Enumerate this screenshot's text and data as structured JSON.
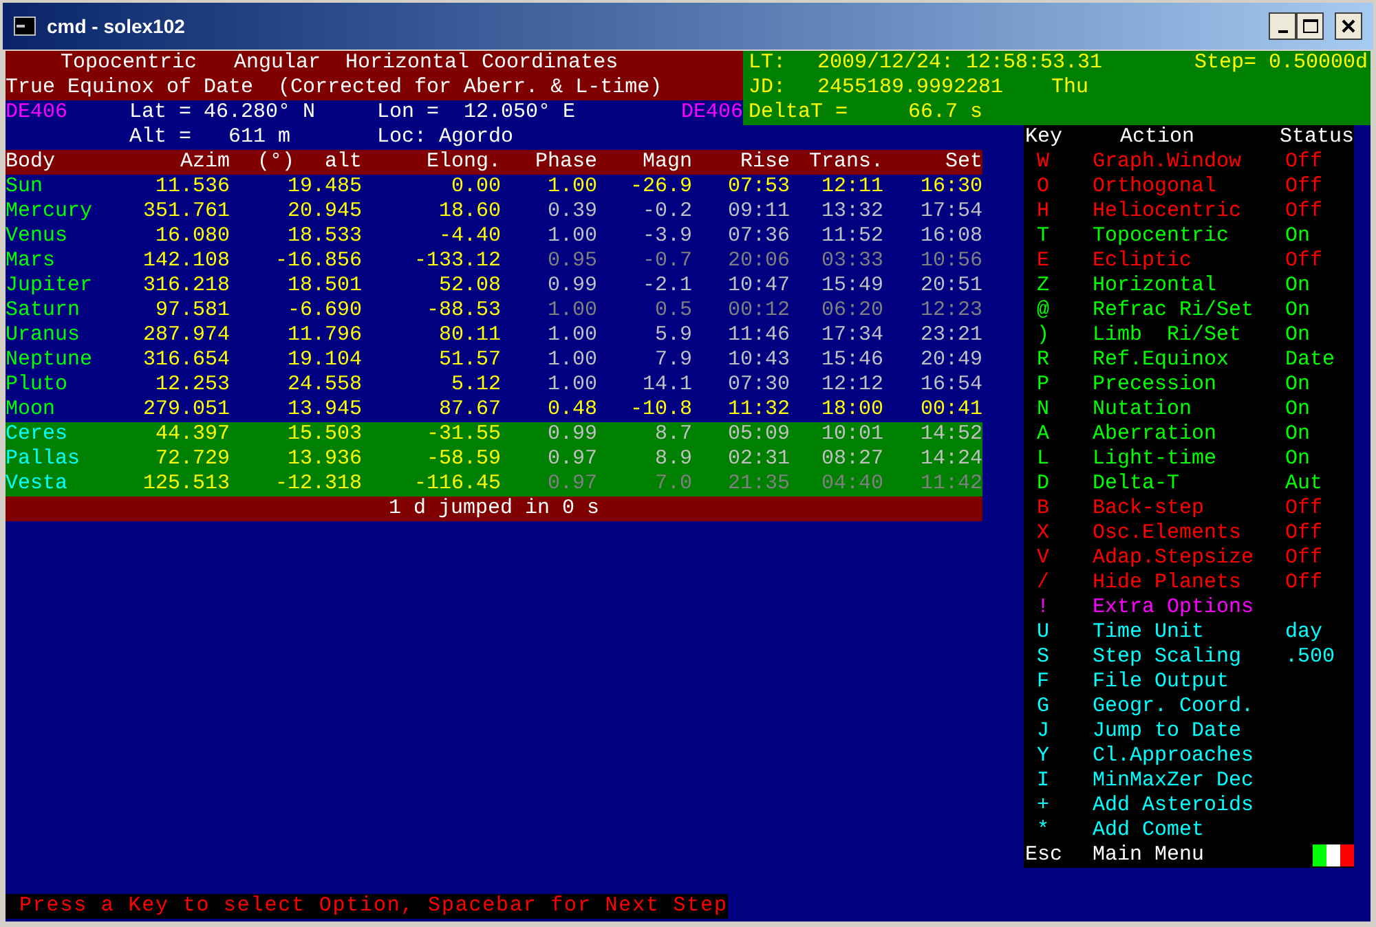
{
  "window": {
    "title": "cmd - solex102"
  },
  "header": {
    "line_1": "Topocentric   Angular  Horizontal Coordinates",
    "line_2": "True Equinox of Date  (Corrected for Aberr. & L-time)",
    "ephemeris_left": "DE406",
    "lat": "Lat = 46.280° N",
    "lon": "Lon =  12.050° E",
    "ephemeris_right": "DE406",
    "alt": "Alt =   611 m",
    "loc": "Loc: Agordo"
  },
  "time_panel": {
    "lt_label": "LT:",
    "lt": "2009/12/24: 12:58:53.31",
    "step": "Step= 0.50000d",
    "jd_label": "JD:",
    "jd": "2455189.9992281",
    "weekday": "Thu",
    "deltat_label": "DeltaT =",
    "deltat": "66.7 s"
  },
  "table": {
    "columns": [
      "Body",
      "Azim",
      "(°)",
      "alt",
      "Elong.",
      "Phase",
      "Magn",
      "Rise",
      "Trans.",
      "Set"
    ],
    "rows": [
      {
        "body": "Sun",
        "azim": "11.536",
        "alt": "19.485",
        "elong": "0.00",
        "phase": "1.00",
        "magn": "-26.9",
        "rise": "07:53",
        "trans": "12:11",
        "set": "16:30",
        "kind": "planet",
        "highlighted": true,
        "dimmed": false
      },
      {
        "body": "Mercury",
        "azim": "351.761",
        "alt": "20.945",
        "elong": "18.60",
        "phase": "0.39",
        "magn": "-0.2",
        "rise": "09:11",
        "trans": "13:32",
        "set": "17:54",
        "kind": "planet",
        "highlighted": false,
        "dimmed": false
      },
      {
        "body": "Venus",
        "azim": "16.080",
        "alt": "18.533",
        "elong": "-4.40",
        "phase": "1.00",
        "magn": "-3.9",
        "rise": "07:36",
        "trans": "11:52",
        "set": "16:08",
        "kind": "planet",
        "highlighted": false,
        "dimmed": false
      },
      {
        "body": "Mars",
        "azim": "142.108",
        "alt": "-16.856",
        "elong": "-133.12",
        "phase": "0.95",
        "magn": "-0.7",
        "rise": "20:06",
        "trans": "03:33",
        "set": "10:56",
        "kind": "planet",
        "highlighted": false,
        "dimmed": true
      },
      {
        "body": "Jupiter",
        "azim": "316.218",
        "alt": "18.501",
        "elong": "52.08",
        "phase": "0.99",
        "magn": "-2.1",
        "rise": "10:47",
        "trans": "15:49",
        "set": "20:51",
        "kind": "planet",
        "highlighted": false,
        "dimmed": false
      },
      {
        "body": "Saturn",
        "azim": "97.581",
        "alt": "-6.690",
        "elong": "-88.53",
        "phase": "1.00",
        "magn": "0.5",
        "rise": "00:12",
        "trans": "06:20",
        "set": "12:23",
        "kind": "planet",
        "highlighted": false,
        "dimmed": true
      },
      {
        "body": "Uranus",
        "azim": "287.974",
        "alt": "11.796",
        "elong": "80.11",
        "phase": "1.00",
        "magn": "5.9",
        "rise": "11:46",
        "trans": "17:34",
        "set": "23:21",
        "kind": "planet",
        "highlighted": false,
        "dimmed": false
      },
      {
        "body": "Neptune",
        "azim": "316.654",
        "alt": "19.104",
        "elong": "51.57",
        "phase": "1.00",
        "magn": "7.9",
        "rise": "10:43",
        "trans": "15:46",
        "set": "20:49",
        "kind": "planet",
        "highlighted": false,
        "dimmed": false
      },
      {
        "body": "Pluto",
        "azim": "12.253",
        "alt": "24.558",
        "elong": "5.12",
        "phase": "1.00",
        "magn": "14.1",
        "rise": "07:30",
        "trans": "12:12",
        "set": "16:54",
        "kind": "planet",
        "highlighted": false,
        "dimmed": false
      },
      {
        "body": "Moon",
        "azim": "279.051",
        "alt": "13.945",
        "elong": "87.67",
        "phase": "0.48",
        "magn": "-10.8",
        "rise": "11:32",
        "trans": "18:00",
        "set": "00:41",
        "kind": "planet",
        "highlighted": true,
        "dimmed": false
      },
      {
        "body": "Ceres",
        "azim": "44.397",
        "alt": "15.503",
        "elong": "-31.55",
        "phase": "0.99",
        "magn": "8.7",
        "rise": "05:09",
        "trans": "10:01",
        "set": "14:52",
        "kind": "asteroid",
        "highlighted": false,
        "dimmed": false
      },
      {
        "body": "Pallas",
        "azim": "72.729",
        "alt": "13.936",
        "elong": "-58.59",
        "phase": "0.97",
        "magn": "8.9",
        "rise": "02:31",
        "trans": "08:27",
        "set": "14:24",
        "kind": "asteroid",
        "highlighted": false,
        "dimmed": false
      },
      {
        "body": "Vesta",
        "azim": "125.513",
        "alt": "-12.318",
        "elong": "-116.45",
        "phase": "0.97",
        "magn": "7.0",
        "rise": "21:35",
        "trans": "04:40",
        "set": "11:42",
        "kind": "asteroid",
        "highlighted": false,
        "dimmed": true
      }
    ]
  },
  "status_line": "1 d jumped in 0 s",
  "menu": {
    "columns": [
      "Key",
      "Action",
      "Status"
    ],
    "items": [
      {
        "key": "W",
        "action": "Graph.Window",
        "status": "Off",
        "color": "#ff0000"
      },
      {
        "key": "O",
        "action": "Orthogonal",
        "status": "Off",
        "color": "#ff0000"
      },
      {
        "key": "H",
        "action": "Heliocentric",
        "status": "Off",
        "color": "#ff0000"
      },
      {
        "key": "T",
        "action": "Topocentric",
        "status": "On",
        "color": "#00ff00"
      },
      {
        "key": "E",
        "action": "Ecliptic",
        "status": "Off",
        "color": "#ff0000"
      },
      {
        "key": "Z",
        "action": "Horizontal",
        "status": "On",
        "color": "#00ff00"
      },
      {
        "key": "@",
        "action": "Refrac Ri/Set",
        "status": "On",
        "color": "#00ff00"
      },
      {
        "key": ")",
        "action": "Limb  Ri/Set",
        "status": "On",
        "color": "#00ff00"
      },
      {
        "key": "R",
        "action": "Ref.Equinox",
        "status": "Date",
        "color": "#00ff00"
      },
      {
        "key": "P",
        "action": "Precession",
        "status": "On",
        "color": "#00ff00"
      },
      {
        "key": "N",
        "action": "Nutation",
        "status": "On",
        "color": "#00ff00"
      },
      {
        "key": "A",
        "action": "Aberration",
        "status": "On",
        "color": "#00ff00"
      },
      {
        "key": "L",
        "action": "Light-time",
        "status": "On",
        "color": "#00ff00"
      },
      {
        "key": "D",
        "action": "Delta-T",
        "status": "Aut",
        "color": "#00ff00"
      },
      {
        "key": "B",
        "action": "Back-step",
        "status": "Off",
        "color": "#ff0000"
      },
      {
        "key": "X",
        "action": "Osc.Elements",
        "status": "Off",
        "color": "#ff0000"
      },
      {
        "key": "V",
        "action": "Adap.Stepsize",
        "status": "Off",
        "color": "#ff0000"
      },
      {
        "key": "/",
        "action": "Hide Planets",
        "status": "Off",
        "color": "#ff0000"
      },
      {
        "key": "!",
        "action": "Extra Options",
        "color": "#ff00ff"
      },
      {
        "key": "U",
        "action": "Time Unit",
        "status": "day",
        "color": "#00ffff"
      },
      {
        "key": "S",
        "action": "Step Scaling",
        "status": ".500",
        "color": "#00ffff"
      },
      {
        "key": "F",
        "action": "File Output",
        "color": "#00ffff"
      },
      {
        "key": "G",
        "action": "Geogr. Coord.",
        "color": "#00ffff"
      },
      {
        "key": "J",
        "action": "Jump to Date",
        "color": "#00ffff"
      },
      {
        "key": "Y",
        "action": "Cl.Approaches",
        "color": "#00ffff"
      },
      {
        "key": "I",
        "action": "MinMaxZer Dec",
        "color": "#00ffff"
      },
      {
        "key": "+",
        "action": "Add Asteroids",
        "color": "#00ffff"
      },
      {
        "key": "*",
        "action": "Add Comet",
        "color": "#00ffff"
      },
      {
        "key": "Esc",
        "action": "Main Menu",
        "color": "#ffffff"
      }
    ]
  },
  "prompt": "Press a Key to select Option, Spacebar for Next Step"
}
